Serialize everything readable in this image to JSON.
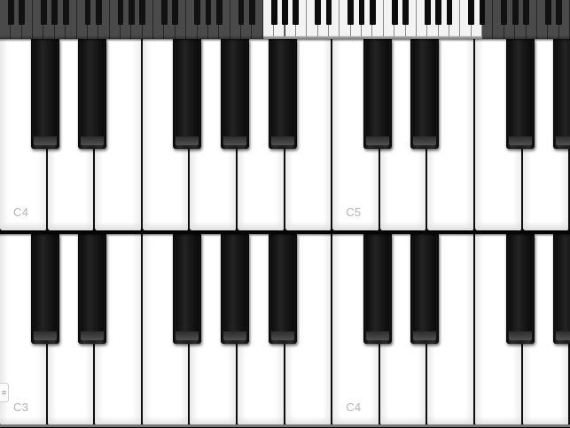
{
  "navigator": {
    "white_key_count": 52,
    "highlight_window": {
      "first_white_index": 24,
      "white_keys_visible": 20
    }
  },
  "keyboards": [
    {
      "name": "upper",
      "first_note": "C4",
      "visible_white_keys": [
        "C",
        "D",
        "E",
        "F",
        "G",
        "A",
        "B",
        "C",
        "D",
        "E",
        "F",
        "G",
        "A"
      ],
      "labels": [
        {
          "white_index": 0,
          "text": "C4"
        },
        {
          "white_index": 7,
          "text": "C5"
        }
      ]
    },
    {
      "name": "lower",
      "first_note": "C3",
      "visible_white_keys": [
        "C",
        "D",
        "E",
        "F",
        "G",
        "A",
        "B",
        "C",
        "D",
        "E",
        "F",
        "G",
        "A"
      ],
      "labels": [
        {
          "white_index": 0,
          "text": "C3"
        },
        {
          "white_index": 7,
          "text": "C4"
        }
      ]
    }
  ],
  "edge_handle": {
    "icon": "menu-lines-icon",
    "glyph": "≡"
  },
  "colors": {
    "white_key": "#ffffff",
    "black_key": "#1c1c1c",
    "label": "#b4b4b4",
    "navigator_highlight": "#f3f3f3",
    "navigator_dim": "#4a4a4a"
  }
}
